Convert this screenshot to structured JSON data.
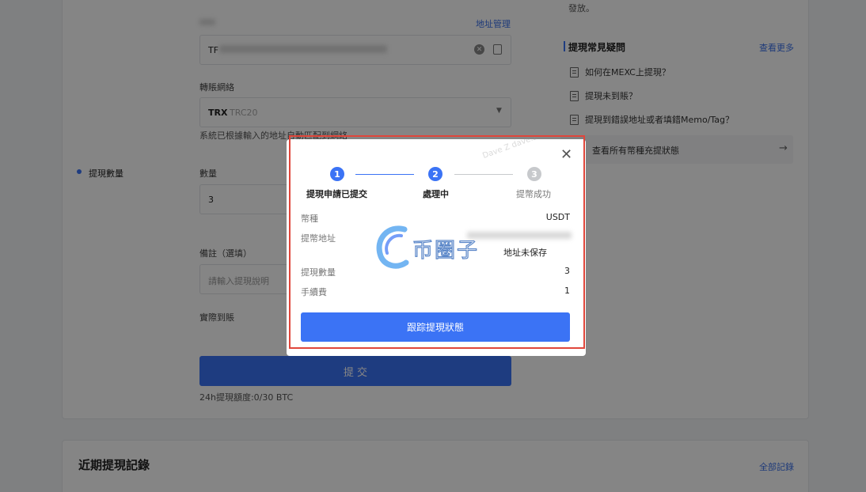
{
  "form": {
    "top_notice": "發放。",
    "address_label_masked": "",
    "address_manage_link": "地址管理",
    "address_value_prefix": "TF",
    "network_label": "轉賬網絡",
    "network_value_main": "TRX",
    "network_value_sub": "TRC20",
    "network_hint": "系統已根據輸入的地址自動匹配到網絡",
    "step_label": "提現數量",
    "amount_label": "數量",
    "amount_value": "3",
    "memo_label": "備註（選填）",
    "memo_placeholder": "請輸入提現說明",
    "actual_label": "實際到賬",
    "submit_label": "提 交",
    "limit_text": "24h提現額度:0/30 BTC"
  },
  "faq": {
    "title": "提現常見疑問",
    "more_link": "查看更多",
    "items": [
      "如何在MEXC上提現？",
      "提現未到賬？",
      "提現到錯誤地址或者填錯Memo/Tag？"
    ],
    "status_link": "查看所有幣種充提狀態"
  },
  "records": {
    "title": "近期提現記錄",
    "all_link": "全部記錄"
  },
  "modal": {
    "steps": [
      {
        "num": "1",
        "label": "提現申請已提交"
      },
      {
        "num": "2",
        "label": "處理中"
      },
      {
        "num": "3",
        "label": "提幣成功"
      }
    ],
    "rows": [
      {
        "key": "幣種",
        "value": "USDT"
      },
      {
        "key": "提幣地址",
        "value": "地址未保存"
      },
      {
        "key": "提現數量",
        "value": "3"
      },
      {
        "key": "手續費",
        "value": "1"
      }
    ],
    "track_button": "跟踪提現狀態",
    "watermark_logo_text": "币圈子",
    "watermark_text": "Dave Z dave.z"
  },
  "colors": {
    "accent": "#3b73f5",
    "highlight_border": "#e0463b",
    "step_inactive": "#c7c9cc"
  }
}
